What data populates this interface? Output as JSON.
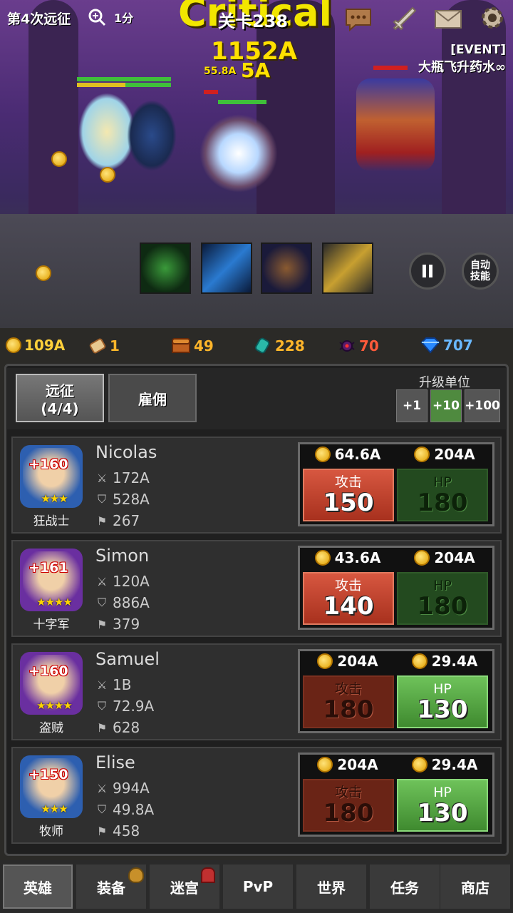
{
  "battle": {
    "expedition_label": "第4次远征",
    "speed_label": "1分",
    "stage_label": "关卡238",
    "critical_text": "Critical",
    "damage_text_1": "1152A",
    "damage_text_2": "5A",
    "damage_text_3": "55.8A",
    "event_tag": "[EVENT]",
    "event_text": "大瓶飞升药水∞",
    "auto_skill_label": "自动\n技能"
  },
  "resources": [
    {
      "icon": "gold-coin-icon",
      "value": "109A",
      "color": "#ffcf3a"
    },
    {
      "icon": "scroll-icon",
      "value": "1",
      "color": "#ffb52a"
    },
    {
      "icon": "treasure-chest-icon",
      "value": "49",
      "color": "#ffb52a"
    },
    {
      "icon": "blue-gem-icon",
      "value": "228",
      "color": "#ffb52a"
    },
    {
      "icon": "spider-icon",
      "value": "70",
      "color": "#ff5a3a"
    },
    {
      "icon": "diamond-icon",
      "value": "707",
      "color": "#6ab8ff"
    }
  ],
  "tabs": {
    "expedition_line1": "远征",
    "expedition_line2": "(4/4)",
    "hire": "雇佣"
  },
  "upgrade_unit": {
    "title": "升级单位",
    "options": [
      "+1",
      "+10",
      "+100"
    ],
    "selected": "+10"
  },
  "heroes": [
    {
      "name": "Nicolas",
      "level": "+160",
      "stars": "★★★",
      "class": "狂战士",
      "attack": "172A",
      "defense": "528A",
      "flag": "267",
      "atk_cost": "64.6A",
      "hp_cost": "204A",
      "atk_label": "攻击",
      "atk_value": "150",
      "hp_label": "HP",
      "hp_value": "180",
      "atk_enabled": true,
      "hp_enabled": false,
      "frame": "#2d5fb0"
    },
    {
      "name": "Simon",
      "level": "+161",
      "stars": "★★★★",
      "class": "十字军",
      "attack": "120A",
      "defense": "886A",
      "flag": "379",
      "atk_cost": "43.6A",
      "hp_cost": "204A",
      "atk_label": "攻击",
      "atk_value": "140",
      "hp_label": "HP",
      "hp_value": "180",
      "atk_enabled": true,
      "hp_enabled": false,
      "frame": "#6a2fa0"
    },
    {
      "name": "Samuel",
      "level": "+160",
      "stars": "★★★★",
      "class": "盗贼",
      "attack": "1B",
      "defense": "72.9A",
      "flag": "628",
      "atk_cost": "204A",
      "hp_cost": "29.4A",
      "atk_label": "攻击",
      "atk_value": "180",
      "hp_label": "HP",
      "hp_value": "130",
      "atk_enabled": false,
      "hp_enabled": true,
      "frame": "#6a2fa0"
    },
    {
      "name": "Elise",
      "level": "+150",
      "stars": "★★★",
      "class": "牧师",
      "attack": "994A",
      "defense": "49.8A",
      "flag": "458",
      "atk_cost": "204A",
      "hp_cost": "29.4A",
      "atk_label": "攻击",
      "atk_value": "180",
      "hp_label": "HP",
      "hp_value": "130",
      "atk_enabled": false,
      "hp_enabled": true,
      "frame": "#2d5fb0"
    }
  ],
  "nav": [
    "英雄",
    "装备",
    "迷宫",
    "PvP",
    "世界",
    "任务",
    "商店"
  ],
  "nav_active": "英雄"
}
